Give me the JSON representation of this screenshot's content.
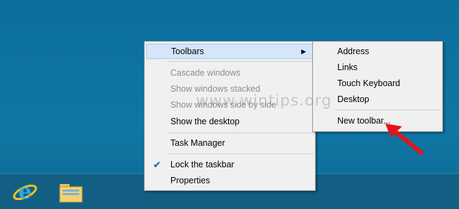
{
  "main_menu": {
    "toolbars": "Toolbars",
    "cascade": "Cascade windows",
    "stacked": "Show windows stacked",
    "side_by_side": "Show windows side by side",
    "show_desktop": "Show the desktop",
    "task_manager": "Task Manager",
    "lock_taskbar": "Lock the taskbar",
    "lock_taskbar_checked": true,
    "properties": "Properties"
  },
  "sub_menu": {
    "address": "Address",
    "links": "Links",
    "touch_keyboard": "Touch Keyboard",
    "desktop": "Desktop",
    "new_toolbar": "New toolbar..."
  },
  "watermark": "www.wintips.org",
  "glyphs": {
    "submenu_arrow": "▶",
    "checkmark": "✔"
  },
  "colors": {
    "desktop": "#0f6f9c",
    "taskbar": "#135f84",
    "highlight": "#d4e6f8",
    "annotation_arrow": "#e0161b"
  },
  "taskbar_icons": [
    "internet-explorer-icon",
    "file-explorer-icon"
  ]
}
